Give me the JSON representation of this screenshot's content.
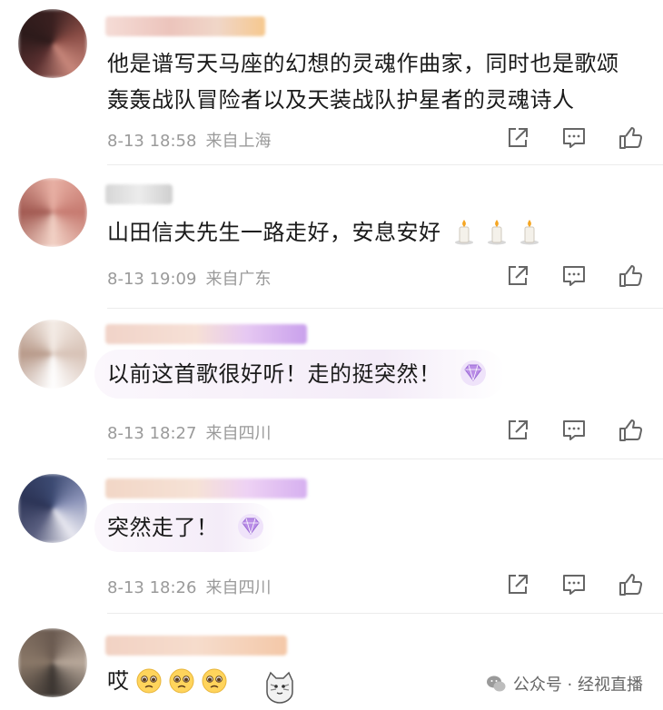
{
  "comments": [
    {
      "text": "他是谱写天马座的幻想的灵魂作曲家，同时也是歌颂轰轰战队冒险者以及天装战队护星者的灵魂诗人",
      "line1": "他是谱写天马座的幻想的灵魂作曲家，同时也是歌颂",
      "line2": "轰轰战队冒险者以及天装战队护星者的灵魂诗人",
      "time": "8-13 18:58",
      "location": "来自上海"
    },
    {
      "text": "山田信夫先生一路走好，安息安好",
      "time": "8-13 19:09",
      "location": "来自广东",
      "emoji": [
        "candle-icon",
        "candle-icon",
        "candle-icon"
      ]
    },
    {
      "text": "以前这首歌很好听！走的挺突然！",
      "time": "8-13 18:27",
      "location": "来自四川",
      "badge": "gem-icon"
    },
    {
      "text": "突然走了！",
      "time": "8-13 18:26",
      "location": "来自四川",
      "badge": "gem-icon"
    },
    {
      "text": "哎",
      "emoji": [
        "pleading-face-icon",
        "pleading-face-icon",
        "pleading-face-icon"
      ]
    }
  ],
  "watermark": "公众号 · 经视直播",
  "colors": {
    "text": "#1a1a1a",
    "meta": "#9a9a9a",
    "icon": "#666666",
    "gem": "#b98ce6"
  }
}
